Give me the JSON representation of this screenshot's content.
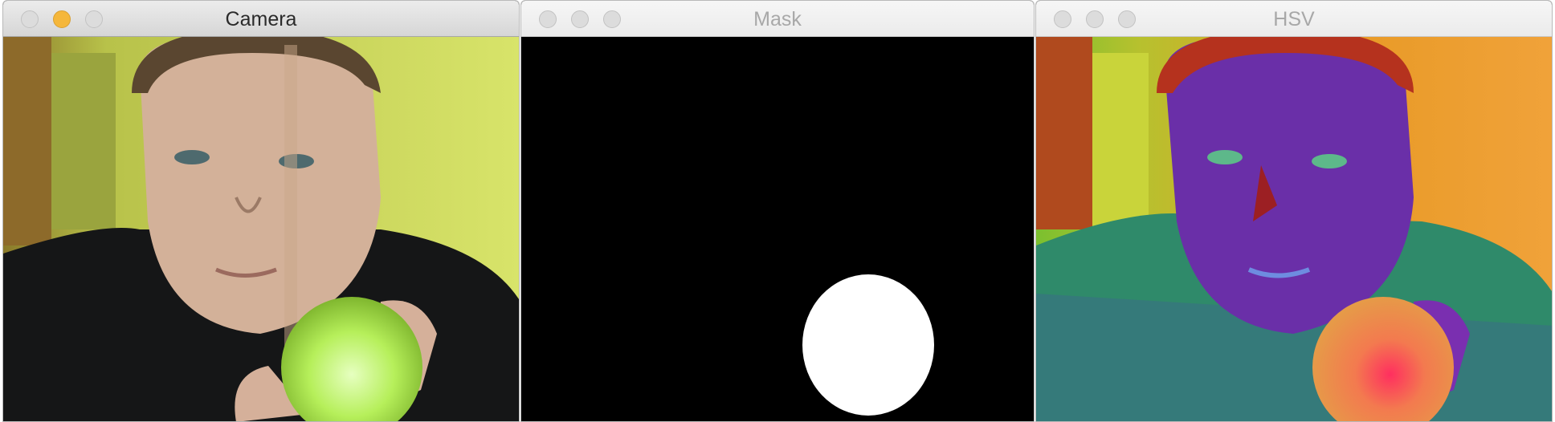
{
  "windows": {
    "camera": {
      "title": "Camera"
    },
    "mask": {
      "title": "Mask"
    },
    "hsv": {
      "title": "HSV"
    }
  },
  "colors": {
    "ball_camera": "#b6ef5a",
    "ball_hsv": "#f37a4f",
    "mask_background": "#000000",
    "mask_blob": "#ffffff",
    "minimize_active": "#f5b73b"
  }
}
